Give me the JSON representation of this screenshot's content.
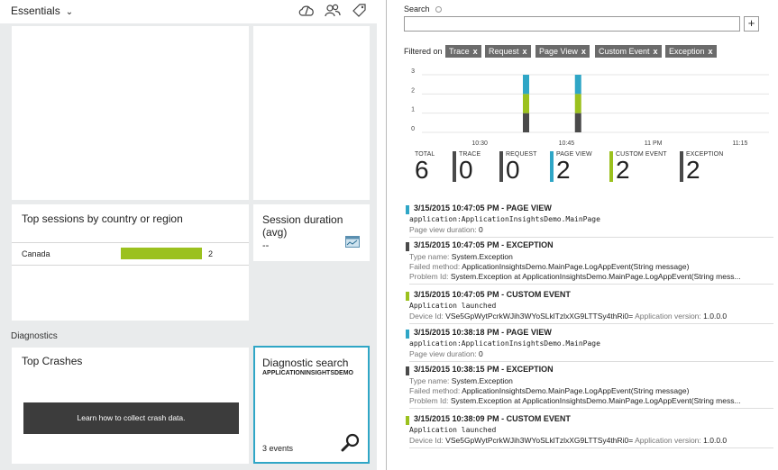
{
  "left": {
    "essentials_label": "Essentials",
    "sessions_tile": {
      "title": "Top sessions by country or region",
      "row_country": "Canada",
      "row_value": "2",
      "bar_fraction": 1.0
    },
    "duration_tile": {
      "title": "Session duration (avg)",
      "value": "--"
    },
    "diagnostics_label": "Diagnostics",
    "crashes_tile": {
      "title": "Top Crashes",
      "button_label": "Learn how to collect crash data."
    },
    "search_tile": {
      "title": "Diagnostic search",
      "subtitle": "APPLICATIONINSIGHTSDEMO",
      "count": "3 events"
    }
  },
  "right": {
    "search_label": "Search",
    "search_value": "",
    "add_label": "+",
    "filtered_on_label": "Filtered on",
    "filters": [
      "Trace",
      "Request",
      "Page View",
      "Custom Event",
      "Exception"
    ],
    "chart_data": {
      "type": "bar",
      "stacked": true,
      "ylim": [
        0,
        3
      ],
      "y_ticks": [
        "3",
        "2",
        "1",
        "0"
      ],
      "x_ticks": [
        "10:30",
        "10:45",
        "11 PM",
        "11:15"
      ],
      "series_colors": {
        "exception": "#4a4a4a",
        "custom_event": "#9bc11e",
        "page_view": "#2fa6c6"
      },
      "bins": [
        {
          "time": "10:38",
          "exception": 1,
          "custom_event": 1,
          "page_view": 1
        },
        {
          "time": "10:47",
          "exception": 1,
          "custom_event": 1,
          "page_view": 1
        }
      ]
    },
    "stats": [
      {
        "label": "TOTAL",
        "value": "6",
        "color": ""
      },
      {
        "label": "TRACE",
        "value": "0",
        "color": "#4a4a4a"
      },
      {
        "label": "REQUEST",
        "value": "0",
        "color": "#4a4a4a"
      },
      {
        "label": "PAGE VIEW",
        "value": "2",
        "color": "#2fa6c6"
      },
      {
        "label": "CUSTOM EVENT",
        "value": "2",
        "color": "#9bc11e"
      },
      {
        "label": "EXCEPTION",
        "value": "2",
        "color": "#4a4a4a"
      }
    ],
    "events": [
      {
        "color": "#2fa6c6",
        "head": "3/15/2015 10:47:05 PM - PAGE VIEW",
        "line1": "application:ApplicationInsightsDemo.MainPage",
        "line2_key": "Page view duration:",
        "line2_val": "0"
      },
      {
        "color": "#4a4a4a",
        "head": "3/15/2015 10:47:05 PM - EXCEPTION",
        "line1_key": "Type name:",
        "line1_val": "System.Exception",
        "line2_key": "Failed method:",
        "line2_val": "ApplicationInsightsDemo.MainPage.LogAppEvent(String message)",
        "line3_key": "Problem Id:",
        "line3_val": "System.Exception at ApplicationInsightsDemo.MainPage.LogAppEvent(String mess..."
      },
      {
        "color": "#9bc11e",
        "head": "3/15/2015 10:47:05 PM - CUSTOM EVENT",
        "line1": "Application launched",
        "line2_key": "Device Id:",
        "line2_val": "VSe5GpWytPcrkWJih3WYoSLklTzlxXG9LTTSy4thRi0=",
        "line2_key2": "Application version:",
        "line2_val2": "1.0.0.0"
      },
      {
        "color": "#2fa6c6",
        "head": "3/15/2015 10:38:18 PM - PAGE VIEW",
        "line1": "application:ApplicationInsightsDemo.MainPage",
        "line2_key": "Page view duration:",
        "line2_val": "0"
      },
      {
        "color": "#4a4a4a",
        "head": "3/15/2015 10:38:15 PM - EXCEPTION",
        "line1_key": "Type name:",
        "line1_val": "System.Exception",
        "line2_key": "Failed method:",
        "line2_val": "ApplicationInsightsDemo.MainPage.LogAppEvent(String message)",
        "line3_key": "Problem Id:",
        "line3_val": "System.Exception at ApplicationInsightsDemo.MainPage.LogAppEvent(String mess..."
      },
      {
        "color": "#9bc11e",
        "head": "3/15/2015 10:38:09 PM - CUSTOM EVENT",
        "line1": "Application launched",
        "line2_key": "Device Id:",
        "line2_val": "VSe5GpWytPcrkWJih3WYoSLklTzlxXG9LTTSy4thRi0=",
        "line2_key2": "Application version:",
        "line2_val2": "1.0.0.0"
      }
    ]
  }
}
